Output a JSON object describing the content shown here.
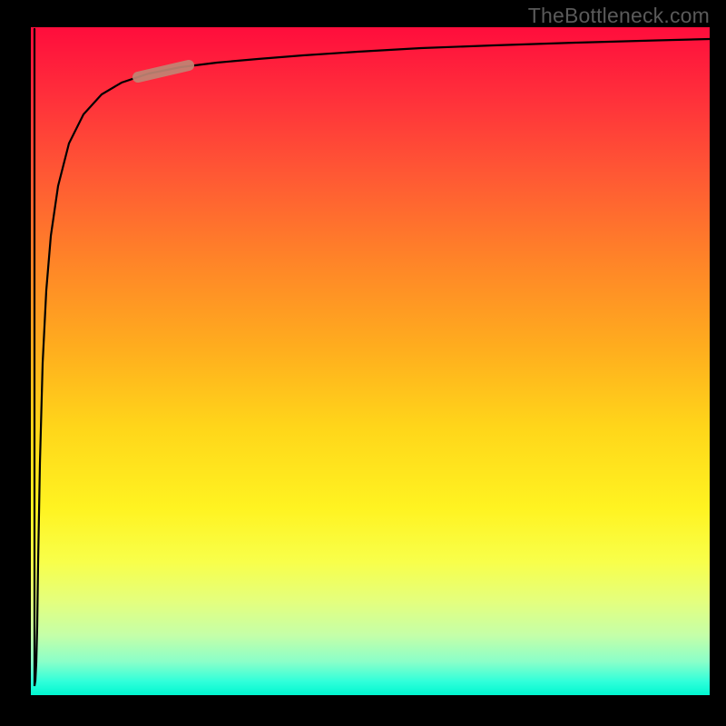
{
  "watermark": "TheBottleneck.com",
  "colors": {
    "gradient_top": "#ff0d3c",
    "gradient_mid": "#ffd61a",
    "gradient_bottom": "#00f7d0",
    "curve": "#000000",
    "highlight": "#c08474",
    "background": "#000000"
  },
  "chart_data": {
    "type": "line",
    "title": "",
    "xlabel": "",
    "ylabel": "",
    "xlim": [
      0,
      100
    ],
    "ylim": [
      0,
      100
    ],
    "x": [
      0.2,
      0.5,
      0.8,
      1.1,
      1.5,
      2,
      3,
      4,
      5,
      6,
      8,
      10,
      12,
      15,
      18,
      22,
      26,
      30,
      35,
      40,
      50,
      60,
      70,
      80,
      90,
      100
    ],
    "values": [
      2,
      8,
      20,
      40,
      60,
      72,
      80,
      84,
      86.5,
      88,
      90,
      91.2,
      92,
      92.8,
      93.4,
      94,
      94.5,
      94.8,
      95.2,
      95.6,
      96.2,
      96.7,
      97.1,
      97.5,
      97.8,
      98.1
    ],
    "highlight_segment": {
      "x_start": 15,
      "x_end": 22,
      "y_start": 92.8,
      "y_end": 94
    },
    "annotations": []
  }
}
